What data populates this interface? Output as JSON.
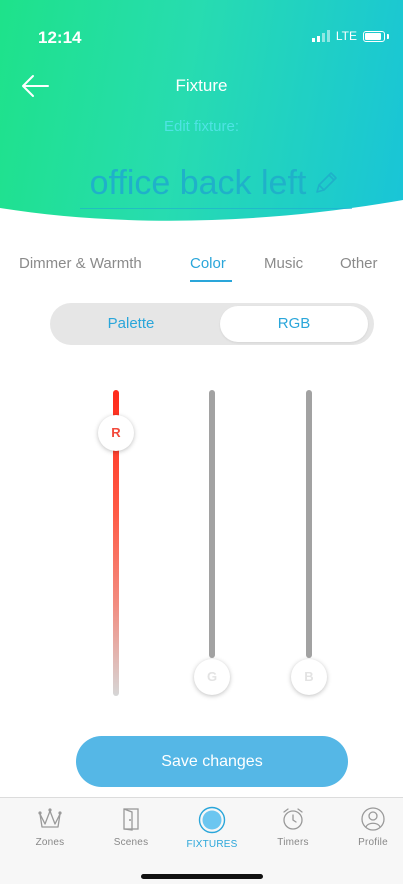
{
  "status_bar": {
    "time": "12:14",
    "network": "LTE"
  },
  "nav": {
    "title": "Fixture",
    "back_icon": "arrow-left-icon"
  },
  "edit": {
    "label": "Edit fixture:",
    "fixture_name": "office back left",
    "edit_icon": "pencil-icon"
  },
  "tabs": [
    {
      "label": "Dimmer & Warmth",
      "active": false
    },
    {
      "label": "Color",
      "active": true
    },
    {
      "label": "Music",
      "active": false
    },
    {
      "label": "Other",
      "active": false
    }
  ],
  "mode_toggle": {
    "options": [
      "Palette",
      "RGB"
    ],
    "selected": "RGB"
  },
  "sliders": [
    {
      "channel": "R",
      "value": 0.85,
      "color": "#f24a3c"
    },
    {
      "channel": "G",
      "value": 0.0,
      "color": "#6ed36e"
    },
    {
      "channel": "B",
      "value": 0.0,
      "color": "#5aa0e0"
    }
  ],
  "save_button": {
    "label": "Save changes"
  },
  "tab_bar": {
    "items": [
      {
        "label": "Zones",
        "icon": "crown-icon"
      },
      {
        "label": "Scenes",
        "icon": "door-icon"
      },
      {
        "label": "FIXTURES",
        "icon": "fixture-bulb-icon",
        "active": true
      },
      {
        "label": "Timers",
        "icon": "alarm-clock-icon"
      },
      {
        "label": "Profile",
        "icon": "profile-icon"
      }
    ]
  },
  "colors": {
    "accent": "#2aa6da",
    "header_start": "#1ee28a",
    "header_end": "#19c4d8",
    "button": "#55b7e6"
  }
}
